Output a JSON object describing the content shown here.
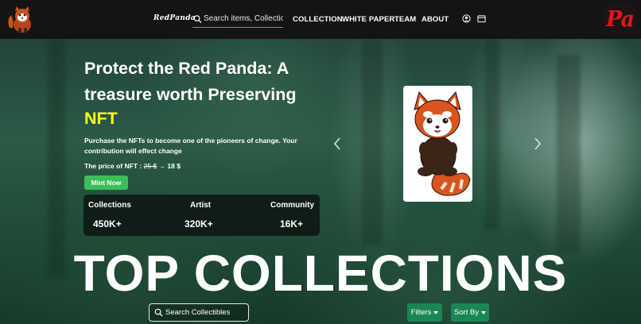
{
  "header": {
    "brand": "RedPanda",
    "search": {
      "placeholder": "Search items, Collections",
      "value": ""
    },
    "nav": [
      {
        "label": "COLLECTION"
      },
      {
        "label": "WHITE PAPER"
      },
      {
        "label": "TEAM"
      },
      {
        "label": "ABOUT"
      }
    ],
    "icons": [
      "user-icon",
      "wallet-icon"
    ],
    "right_logo_text": "Pa"
  },
  "hero": {
    "title": "Protect the Red Panda: A treasure worth Preserving",
    "highlight": "NFT",
    "description": "Purchase the NFTs to become one of the pioneers of change. Your contribution will effect change",
    "price_label": "The price of NFT :",
    "price_old": "25 $",
    "price_arrow": "→",
    "price_new": "18 $",
    "mint_label": "Mint Now"
  },
  "stats": [
    {
      "label": "Collections",
      "value": "450K+"
    },
    {
      "label": "Artist",
      "value": "320K+"
    },
    {
      "label": "Community",
      "value": "16K+"
    }
  ],
  "carousel": {
    "prev_icon": "chevron-left-icon",
    "next_icon": "chevron-right-icon"
  },
  "collections": {
    "title": "TOP COLLECTIONS",
    "search_placeholder": "Search Collectibles",
    "filters_label": "Filters",
    "sort_label": "Sort By"
  },
  "colors": {
    "accent_yellow": "#ffff18",
    "mint_green": "#3ebd5b",
    "button_green": "#198754",
    "header_bg": "#141414",
    "logo_red": "#e0161c"
  }
}
